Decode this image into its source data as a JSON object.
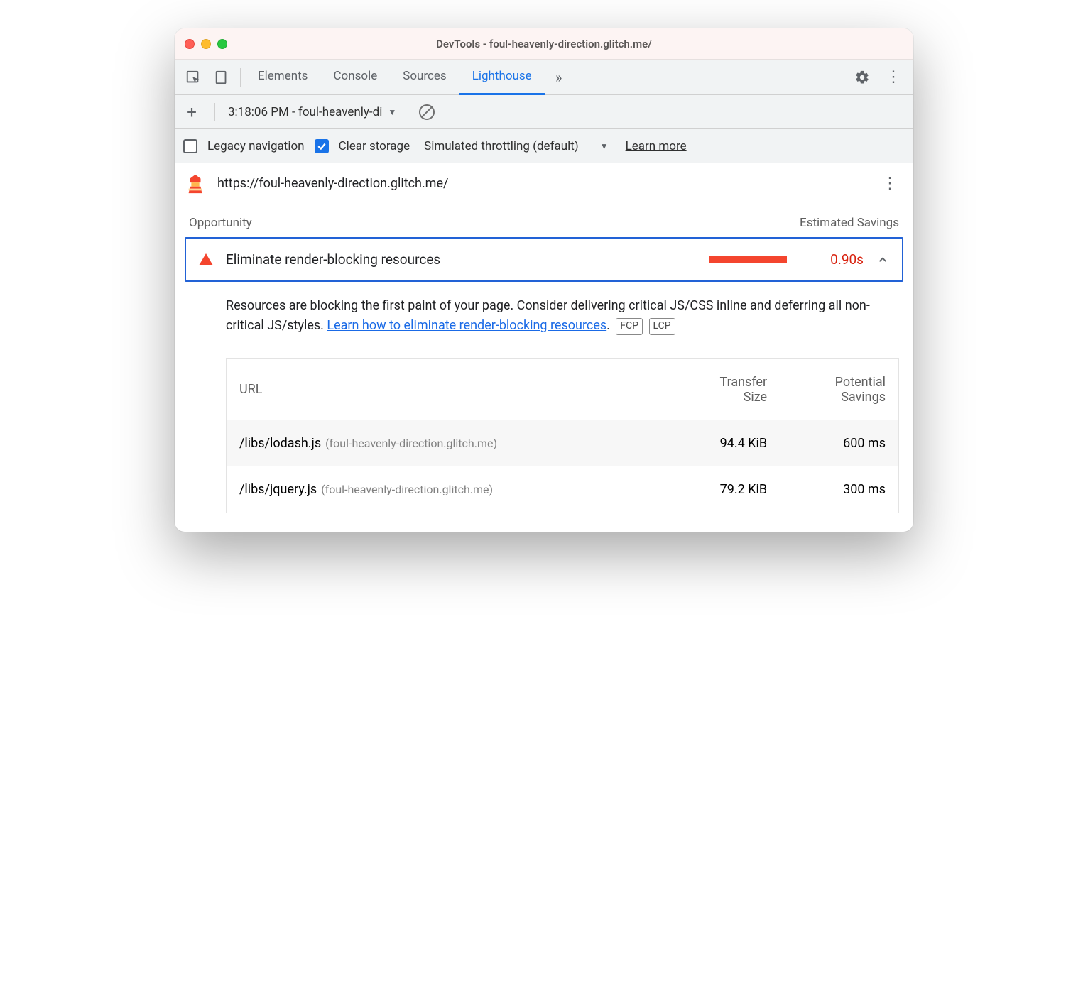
{
  "window": {
    "title": "DevTools - foul-heavenly-direction.glitch.me/"
  },
  "tabs": {
    "items": [
      "Elements",
      "Console",
      "Sources",
      "Lighthouse"
    ],
    "active": "Lighthouse"
  },
  "toolbar1": {
    "report_selector": "3:18:06 PM - foul-heavenly-di"
  },
  "toolbar2": {
    "legacy_label": "Legacy navigation",
    "legacy_checked": false,
    "clear_label": "Clear storage",
    "clear_checked": true,
    "throttling_label": "Simulated throttling (default)",
    "learn_more": "Learn more"
  },
  "urlrow": {
    "url": "https://foul-heavenly-direction.glitch.me/"
  },
  "section": {
    "left": "Opportunity",
    "right": "Estimated Savings"
  },
  "audit": {
    "title": "Eliminate render-blocking resources",
    "value": "0.90s"
  },
  "description": {
    "text1": "Resources are blocking the first paint of your page. Consider delivering critical JS/CSS inline and deferring all non-critical JS/styles. ",
    "link_text": "Learn how to eliminate render-blocking resources",
    "text2": ".",
    "badge1": "FCP",
    "badge2": "LCP"
  },
  "table": {
    "headers": {
      "url": "URL",
      "size": "Transfer Size",
      "savings": "Potential Savings"
    },
    "rows": [
      {
        "path": "/libs/lodash.js",
        "origin": "(foul-heavenly-direction.glitch.me)",
        "size": "94.4 KiB",
        "savings": "600 ms"
      },
      {
        "path": "/libs/jquery.js",
        "origin": "(foul-heavenly-direction.glitch.me)",
        "size": "79.2 KiB",
        "savings": "300 ms"
      }
    ]
  }
}
